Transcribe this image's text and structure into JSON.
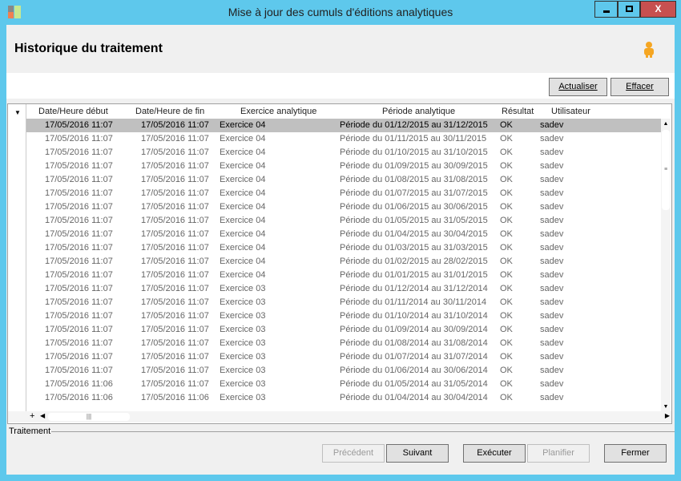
{
  "window": {
    "title": "Mise à jour des cumuls d'éditions analytiques",
    "minimize": "▁",
    "maximize": "□",
    "close": "X"
  },
  "header": {
    "title": "Historique du traitement",
    "icon": "person-icon"
  },
  "toolbar": {
    "refresh": "Actualiser",
    "clear": "Effacer"
  },
  "table": {
    "columns": [
      "Date/Heure début",
      "Date/Heure de fin",
      "Exercice analytique",
      "Période analytique",
      "Résultat",
      "Utilisateur"
    ],
    "rows": [
      [
        "17/05/2016 11:07",
        "17/05/2016 11:07",
        "Exercice 04",
        "Période du 01/12/2015 au 31/12/2015",
        "OK",
        "sadev"
      ],
      [
        "17/05/2016 11:07",
        "17/05/2016 11:07",
        "Exercice 04",
        "Période du 01/11/2015 au 30/11/2015",
        "OK",
        "sadev"
      ],
      [
        "17/05/2016 11:07",
        "17/05/2016 11:07",
        "Exercice 04",
        "Période du 01/10/2015 au 31/10/2015",
        "OK",
        "sadev"
      ],
      [
        "17/05/2016 11:07",
        "17/05/2016 11:07",
        "Exercice 04",
        "Période du 01/09/2015 au 30/09/2015",
        "OK",
        "sadev"
      ],
      [
        "17/05/2016 11:07",
        "17/05/2016 11:07",
        "Exercice 04",
        "Période du 01/08/2015 au 31/08/2015",
        "OK",
        "sadev"
      ],
      [
        "17/05/2016 11:07",
        "17/05/2016 11:07",
        "Exercice 04",
        "Période du 01/07/2015 au 31/07/2015",
        "OK",
        "sadev"
      ],
      [
        "17/05/2016 11:07",
        "17/05/2016 11:07",
        "Exercice 04",
        "Période du 01/06/2015 au 30/06/2015",
        "OK",
        "sadev"
      ],
      [
        "17/05/2016 11:07",
        "17/05/2016 11:07",
        "Exercice 04",
        "Période du 01/05/2015 au 31/05/2015",
        "OK",
        "sadev"
      ],
      [
        "17/05/2016 11:07",
        "17/05/2016 11:07",
        "Exercice 04",
        "Période du 01/04/2015 au 30/04/2015",
        "OK",
        "sadev"
      ],
      [
        "17/05/2016 11:07",
        "17/05/2016 11:07",
        "Exercice 04",
        "Période du 01/03/2015 au 31/03/2015",
        "OK",
        "sadev"
      ],
      [
        "17/05/2016 11:07",
        "17/05/2016 11:07",
        "Exercice 04",
        "Période du 01/02/2015 au 28/02/2015",
        "OK",
        "sadev"
      ],
      [
        "17/05/2016 11:07",
        "17/05/2016 11:07",
        "Exercice 04",
        "Période du 01/01/2015 au 31/01/2015",
        "OK",
        "sadev"
      ],
      [
        "17/05/2016 11:07",
        "17/05/2016 11:07",
        "Exercice 03",
        "Période du 01/12/2014 au 31/12/2014",
        "OK",
        "sadev"
      ],
      [
        "17/05/2016 11:07",
        "17/05/2016 11:07",
        "Exercice 03",
        "Période du 01/11/2014 au 30/11/2014",
        "OK",
        "sadev"
      ],
      [
        "17/05/2016 11:07",
        "17/05/2016 11:07",
        "Exercice 03",
        "Période du 01/10/2014 au 31/10/2014",
        "OK",
        "sadev"
      ],
      [
        "17/05/2016 11:07",
        "17/05/2016 11:07",
        "Exercice 03",
        "Période du 01/09/2014 au 30/09/2014",
        "OK",
        "sadev"
      ],
      [
        "17/05/2016 11:07",
        "17/05/2016 11:07",
        "Exercice 03",
        "Période du 01/08/2014 au 31/08/2014",
        "OK",
        "sadev"
      ],
      [
        "17/05/2016 11:07",
        "17/05/2016 11:07",
        "Exercice 03",
        "Période du 01/07/2014 au 31/07/2014",
        "OK",
        "sadev"
      ],
      [
        "17/05/2016 11:07",
        "17/05/2016 11:07",
        "Exercice 03",
        "Période du 01/06/2014 au 30/06/2014",
        "OK",
        "sadev"
      ],
      [
        "17/05/2016 11:06",
        "17/05/2016 11:07",
        "Exercice 03",
        "Période du 01/05/2014 au 31/05/2014",
        "OK",
        "sadev"
      ],
      [
        "17/05/2016 11:06",
        "17/05/2016 11:06",
        "Exercice 03",
        "Période du 01/04/2014 au 30/04/2014",
        "OK",
        "sadev"
      ]
    ],
    "selected_row": 0,
    "expand": "+"
  },
  "footer": {
    "group_label": "Traitement",
    "previous": "Précédent",
    "next": "Suivant",
    "execute": "Exécuter",
    "schedule": "Planifier",
    "close": "Fermer"
  }
}
